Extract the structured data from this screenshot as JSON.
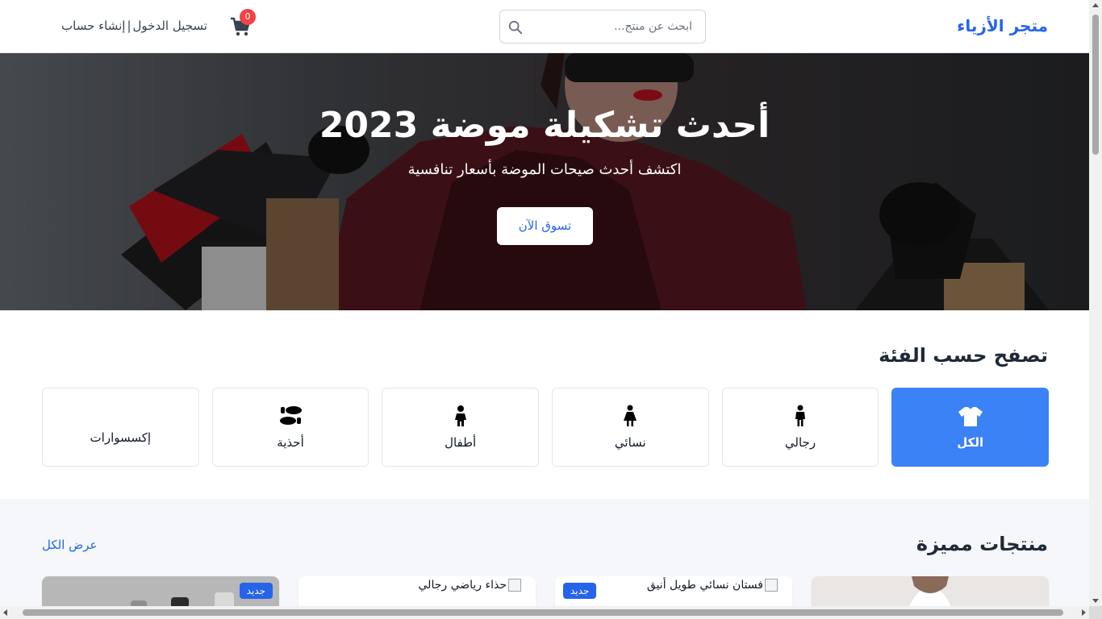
{
  "header": {
    "brand": "متجر الأزياء",
    "search_placeholder": "ابحث عن منتج...",
    "cart_count": "0",
    "login_label": "تسجيل الدخول",
    "separator": "|",
    "register_label": "إنشاء حساب"
  },
  "hero": {
    "title": "أحدث تشكيلة موضة 2023",
    "subtitle": "اكتشف أحدث صيحات الموضة بأسعار تنافسية",
    "cta_label": "تسوق الآن"
  },
  "categories": {
    "title": "تصفح حسب الفئة",
    "items": [
      {
        "label": "الكل",
        "icon": "tshirt-icon",
        "active": true
      },
      {
        "label": "رجالي",
        "icon": "male-icon",
        "active": false
      },
      {
        "label": "نسائي",
        "icon": "female-icon",
        "active": false
      },
      {
        "label": "أطفال",
        "icon": "child-icon",
        "active": false
      },
      {
        "label": "أحذية",
        "icon": "shoe-prints-icon",
        "active": false
      },
      {
        "label": "إكسسوارات",
        "icon": "",
        "active": false
      }
    ]
  },
  "featured": {
    "title": "منتجات مميزة",
    "view_all_label": "عرض الكل",
    "products": [
      {
        "image_alt": "",
        "badge": ""
      },
      {
        "image_alt": "فستان نسائي طويل أنيق",
        "badge": "جديد"
      },
      {
        "image_alt": "حذاء رياضي رجالي",
        "badge": ""
      },
      {
        "image_alt": "",
        "badge": "جديد"
      }
    ]
  },
  "colors": {
    "accent": "#2563eb",
    "active_category": "#3b82f6",
    "badge": "#ef4444"
  }
}
